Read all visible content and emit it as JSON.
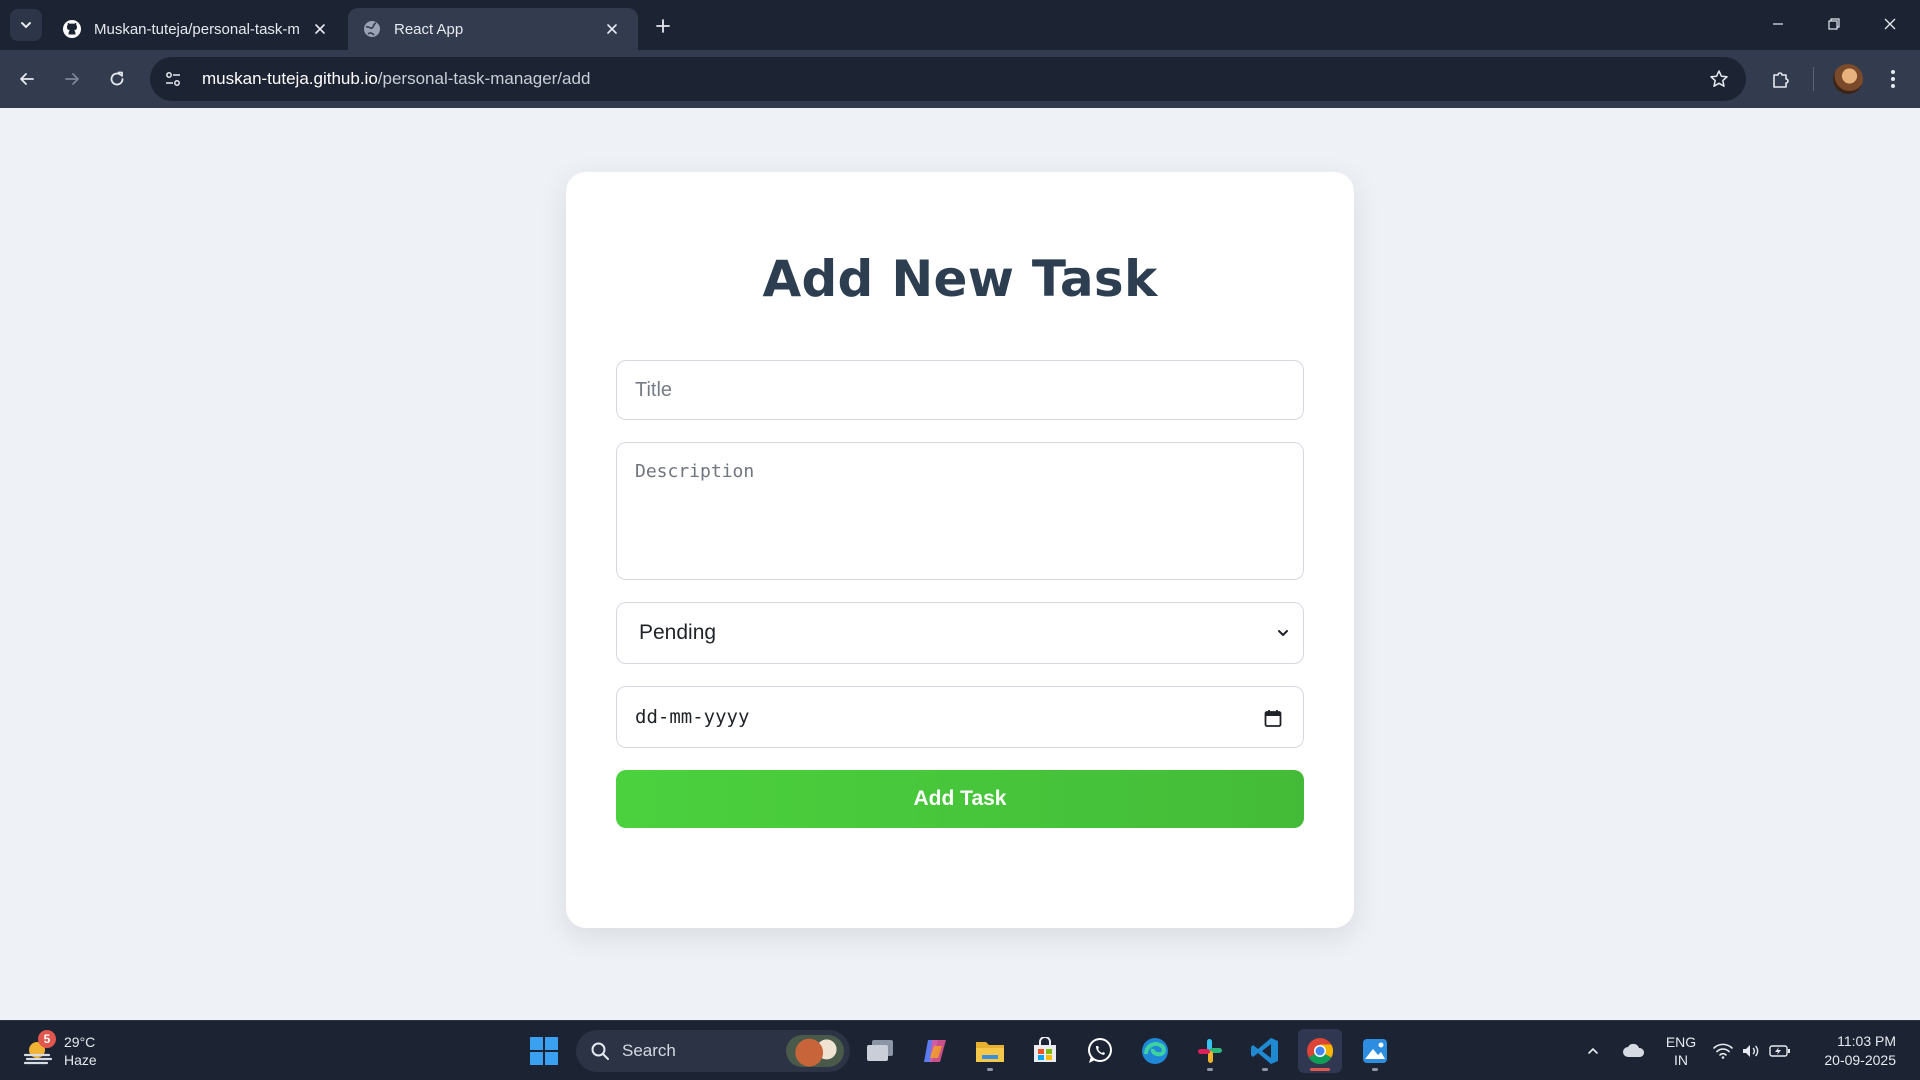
{
  "browser": {
    "tabs": [
      {
        "title": "Muskan-tuteja/personal-task-m",
        "favicon": "github-icon"
      },
      {
        "title": "React App",
        "favicon": "globe-icon"
      }
    ],
    "url_domain": "muskan-tuteja.github.io",
    "url_path": "/personal-task-manager/add"
  },
  "form": {
    "heading": "Add New Task",
    "title_placeholder": "Title",
    "description_placeholder": "Description",
    "status_selected": "Pending",
    "date_placeholder": "dd-mm-yyyy",
    "submit_label": "Add Task"
  },
  "taskbar": {
    "weather_temp": "29°C",
    "weather_desc": "Haze",
    "weather_badge": "5",
    "search_label": "Search",
    "language_line1": "ENG",
    "language_line2": "IN",
    "time": "11:03 PM",
    "date": "20-09-2025"
  },
  "colors": {
    "page_background": "#eef1f5",
    "heading": "#2c3e50",
    "submit_button": "#4bd13e",
    "browser_frame": "#1c2333"
  }
}
